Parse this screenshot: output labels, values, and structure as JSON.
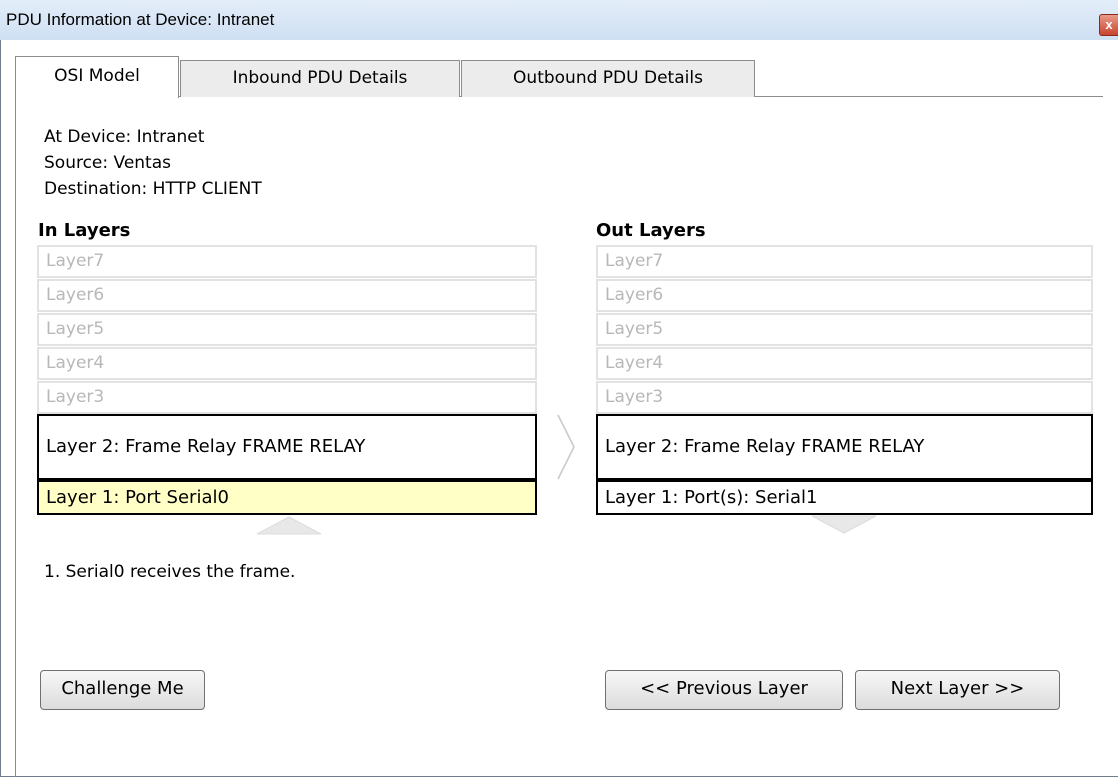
{
  "window": {
    "title": "PDU Information at Device: Intranet",
    "close_glyph": "x"
  },
  "tabs": [
    {
      "label": "OSI Model",
      "active": true
    },
    {
      "label": "Inbound PDU Details",
      "active": false
    },
    {
      "label": "Outbound PDU Details",
      "active": false
    }
  ],
  "info": {
    "at_device": "At Device: Intranet",
    "source": "Source: Ventas",
    "destination": "Destination: HTTP CLIENT"
  },
  "in_layers": {
    "heading": "In Layers",
    "layers": [
      "Layer7",
      "Layer6",
      "Layer5",
      "Layer4",
      "Layer3",
      "Layer 2: Frame Relay FRAME RELAY",
      "Layer 1: Port Serial0"
    ],
    "highlighted": "Layer 1: Port Serial0"
  },
  "out_layers": {
    "heading": "Out Layers",
    "layers": [
      "Layer7",
      "Layer6",
      "Layer5",
      "Layer4",
      "Layer3",
      "Layer 2: Frame Relay FRAME RELAY",
      "Layer 1: Port(s): Serial1"
    ]
  },
  "icons": {
    "in_direction": "up-arrow-icon",
    "between": "right-chevron-icon",
    "out_direction": "down-arrow-icon"
  },
  "description": "1. Serial0 receives the frame.",
  "buttons": {
    "challenge": "Challenge Me",
    "previous": "<< Previous Layer",
    "next": "Next Layer >>"
  },
  "colors": {
    "highlight": "#ffffc6",
    "inactive_layer_text": "#b8b8b8"
  }
}
